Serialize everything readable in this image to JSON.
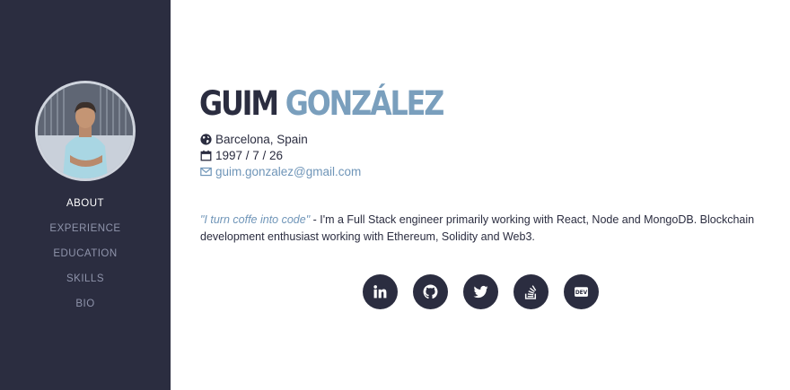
{
  "profile": {
    "first_name": "GUIM",
    "last_name": "GONZÁLEZ",
    "location": "Barcelona, Spain",
    "birthdate": "1997 / 7 / 26",
    "email": "guim.gonzalez@gmail.com"
  },
  "nav": {
    "items": [
      {
        "label": "ABOUT",
        "active": true
      },
      {
        "label": "EXPERIENCE",
        "active": false
      },
      {
        "label": "EDUCATION",
        "active": false
      },
      {
        "label": "SKILLS",
        "active": false
      },
      {
        "label": "BIO",
        "active": false
      }
    ]
  },
  "bio": {
    "quote": "\"I turn coffe into code\"",
    "text": " - I'm a Full Stack engineer primarily working with React, Node and MongoDB. Blockchain development enthusiast working with Ethereum, Solidity and Web3."
  },
  "socials": [
    "linkedin-icon",
    "github-icon",
    "twitter-icon",
    "stackoverflow-icon",
    "dev-icon"
  ],
  "colors": {
    "sidebar": "#2b2d40",
    "accent": "#7a9fbd",
    "link": "#6f95b8",
    "text": "#2b2d40",
    "nav_inactive": "#8f94ab"
  }
}
